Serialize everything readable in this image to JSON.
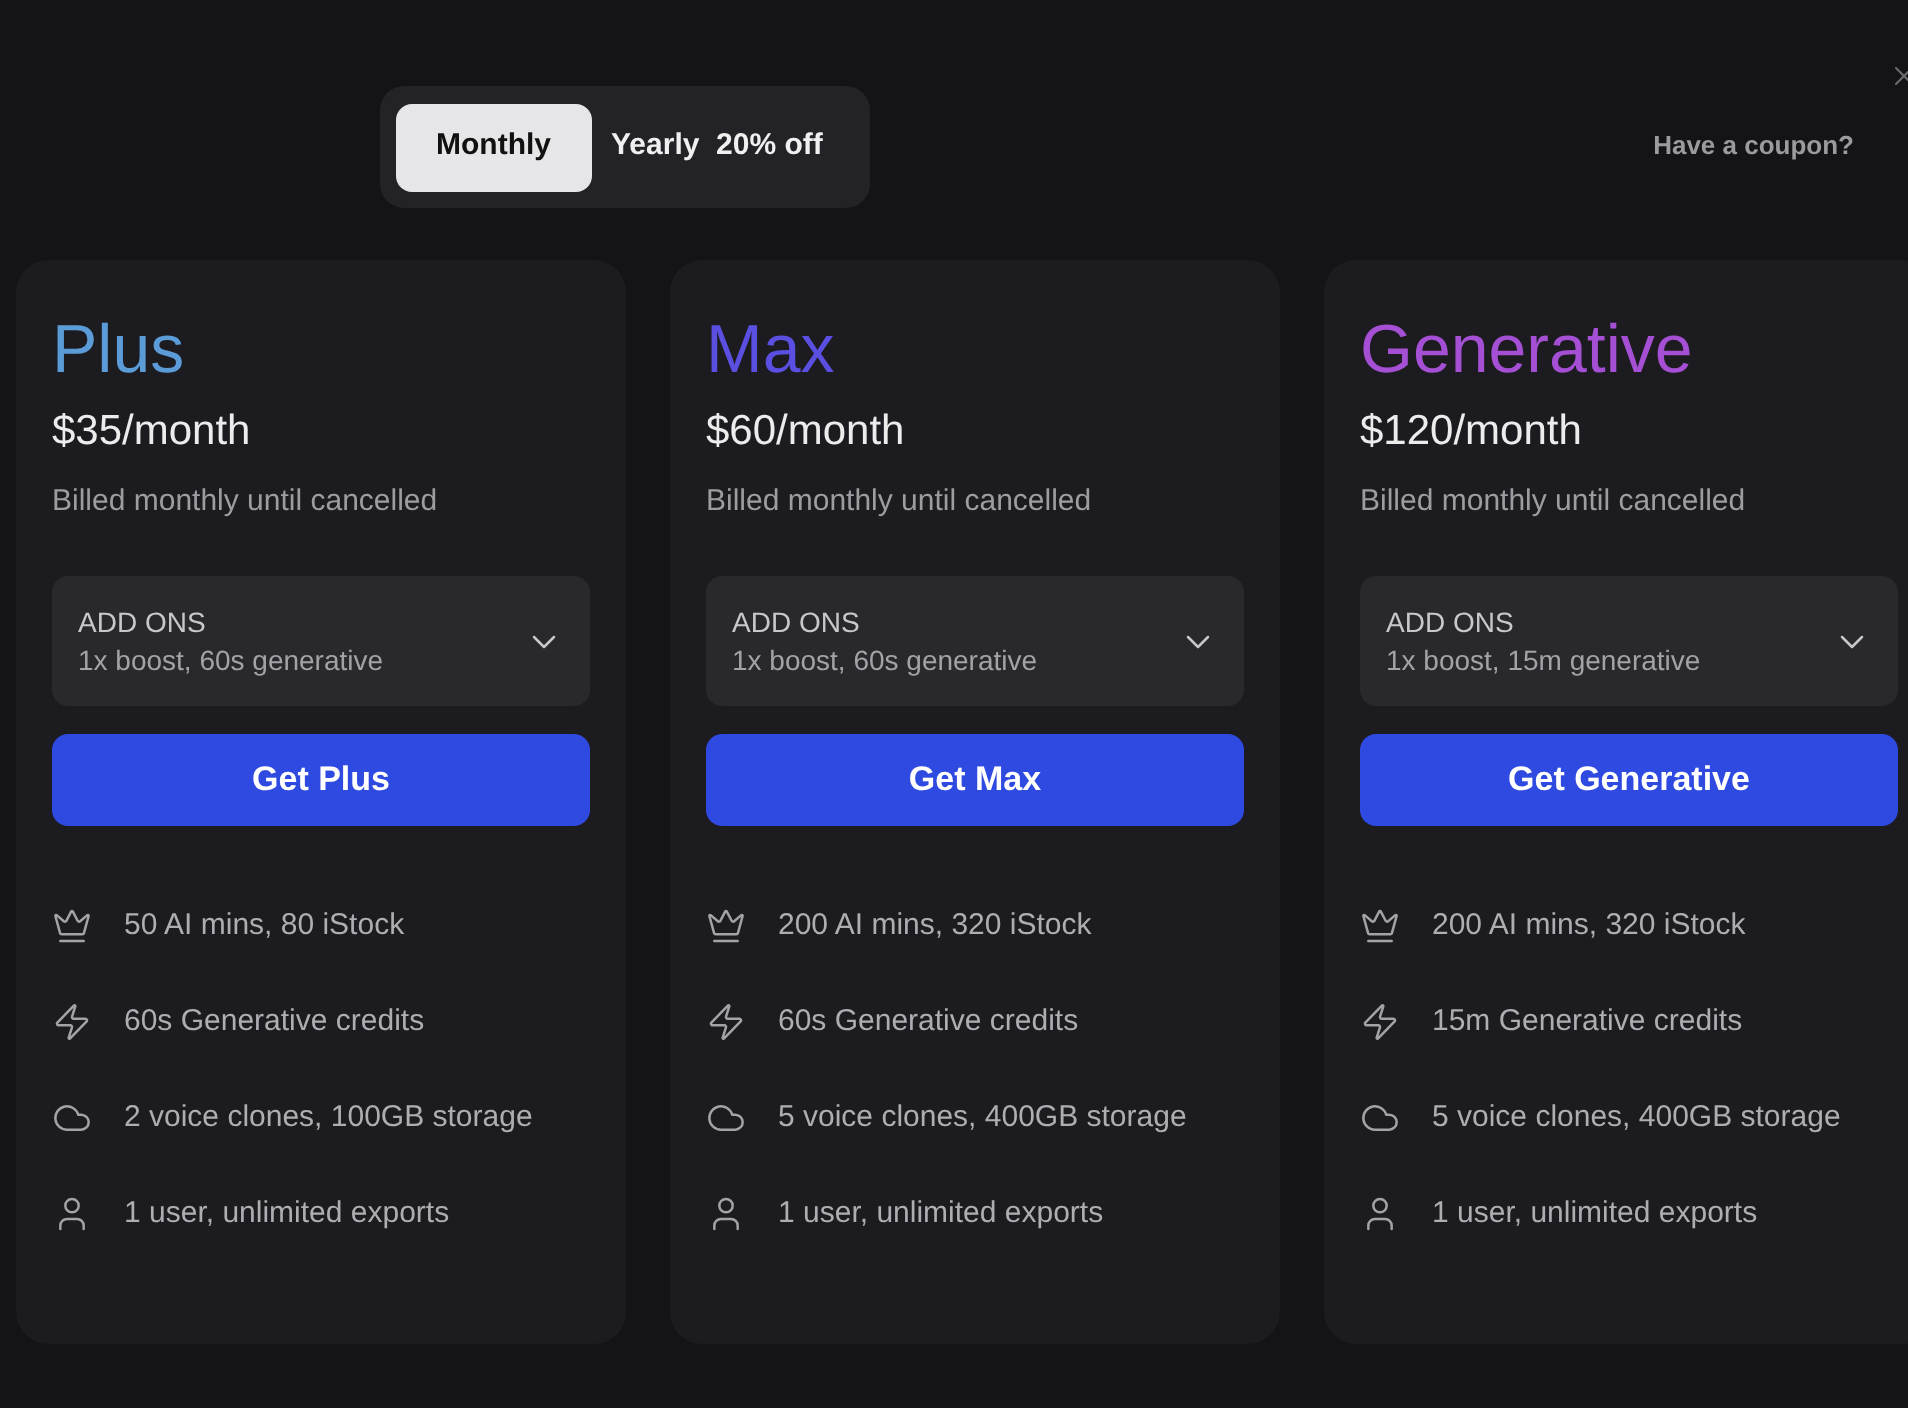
{
  "billing_toggle": [
    {
      "label": "Monthly",
      "selected": true
    },
    {
      "label": "Yearly  20% off",
      "selected": false
    }
  ],
  "coupon_link": "Have a coupon?",
  "plans": [
    {
      "name": "Plus",
      "color": "#5b9bd8",
      "price": "$35/month",
      "billing_note": "Billed monthly until cancelled",
      "addons": {
        "label": "ADD ONS",
        "value": "1x boost, 60s generative"
      },
      "button": "Get Plus",
      "features": [
        {
          "kind": "crown",
          "text": "50 AI mins, 80 iStock"
        },
        {
          "kind": "bolt",
          "text": "60s Generative credits"
        },
        {
          "kind": "cloud",
          "text": "2 voice clones, 100GB storage"
        },
        {
          "kind": "user",
          "text": "1 user, unlimited exports"
        }
      ]
    },
    {
      "name": "Max",
      "color": "#5a4fe0",
      "price": "$60/month",
      "billing_note": "Billed monthly until cancelled",
      "addons": {
        "label": "ADD ONS",
        "value": "1x boost, 60s generative"
      },
      "button": "Get Max",
      "features": [
        {
          "kind": "crown",
          "text": "200 AI mins, 320 iStock"
        },
        {
          "kind": "bolt",
          "text": "60s Generative credits"
        },
        {
          "kind": "cloud",
          "text": "5 voice clones, 400GB storage"
        },
        {
          "kind": "user",
          "text": "1 user, unlimited exports"
        }
      ]
    },
    {
      "name": "Generative",
      "color": "#a44fd4",
      "price": "$120/month",
      "billing_note": "Billed monthly until cancelled",
      "addons": {
        "label": "ADD ONS",
        "value": "1x boost, 15m generative"
      },
      "button": "Get Generative",
      "features": [
        {
          "kind": "crown",
          "text": "200 AI mins, 320 iStock"
        },
        {
          "kind": "bolt",
          "text": "15m Generative credits"
        },
        {
          "kind": "cloud",
          "text": "5 voice clones, 400GB storage"
        },
        {
          "kind": "user",
          "text": "1 user, unlimited exports"
        }
      ]
    }
  ]
}
